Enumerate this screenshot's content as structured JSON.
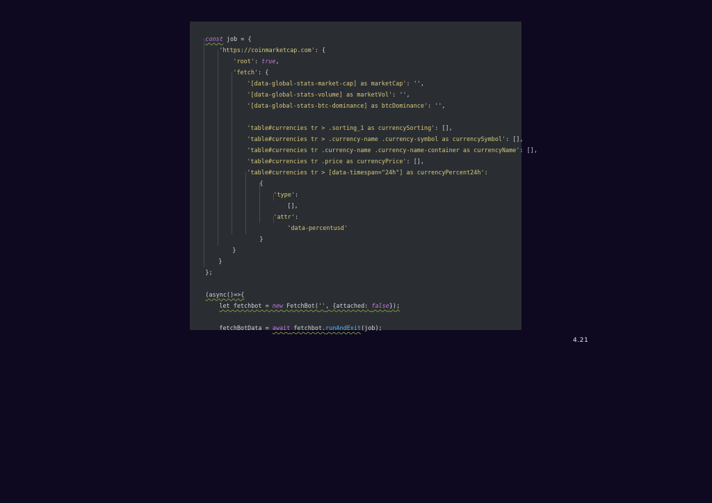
{
  "code": {
    "l01_const": "const",
    "l01_rest": " job = {",
    "l02_str": "'https://coinmarketcap.com'",
    "l02_rest": ": {",
    "l03_str": "'root'",
    "l03_colon": ": ",
    "l03_bool": "true",
    "l03_comma": ",",
    "l04_str": "'fetch'",
    "l04_rest": ": {",
    "l05_str": "'[data-global-stats-market-cap] as marketCap'",
    "l05_rest": ": '',",
    "l06_str": "'[data-global-stats-volume] as marketVol'",
    "l06_rest": ": '',",
    "l07_str": "'[data-global-stats-btc-dominance] as btcDominance'",
    "l07_rest": ": '',",
    "l09_str": "'table#currencies tr > .sorting_1 as currencySorting'",
    "l09_rest": ": [],",
    "l10_str": "'table#currencies tr > .currency-name .currency-symbol as currencySymbol'",
    "l10_rest": ": [],",
    "l11_str": "'table#currencies tr .currency-name .currency-name-container as currencyName'",
    "l11_rest": ": [],",
    "l12_str": "'table#currencies tr .price as currencyPrice'",
    "l12_rest": ": [],",
    "l13_str": "'table#currencies tr > [data-timespan=\"24h\"] as currencyPercent24h'",
    "l13_rest": ":",
    "l14": "{",
    "l15_str": "'type'",
    "l15_rest": ":",
    "l16": "[],",
    "l17_str": "'attr'",
    "l17_rest": ":",
    "l18_str": "'data-percentusd'",
    "l19": "}",
    "l20": "}",
    "l21": "}",
    "l22": "};",
    "l24": "(async()=>{",
    "l25_a": "let fetchbot = ",
    "l25_new": "new",
    "l25_b": " FetchBot(",
    "l25_str": "''",
    "l25_c": ", {attached: ",
    "l25_false": "false",
    "l25_d": "});",
    "l27_a": "fetchBotData = ",
    "l27_await": "await",
    "l27_b": " fetchbot.",
    "l27_fn": "runAndExit",
    "l27_c": "(job);"
  },
  "slide": {
    "number": "4.21"
  },
  "colors": {
    "background": "#0e0821",
    "editor": "#2a2e33",
    "string": "#d7c97a",
    "keyword": "#c678dd",
    "function": "#61afef"
  }
}
